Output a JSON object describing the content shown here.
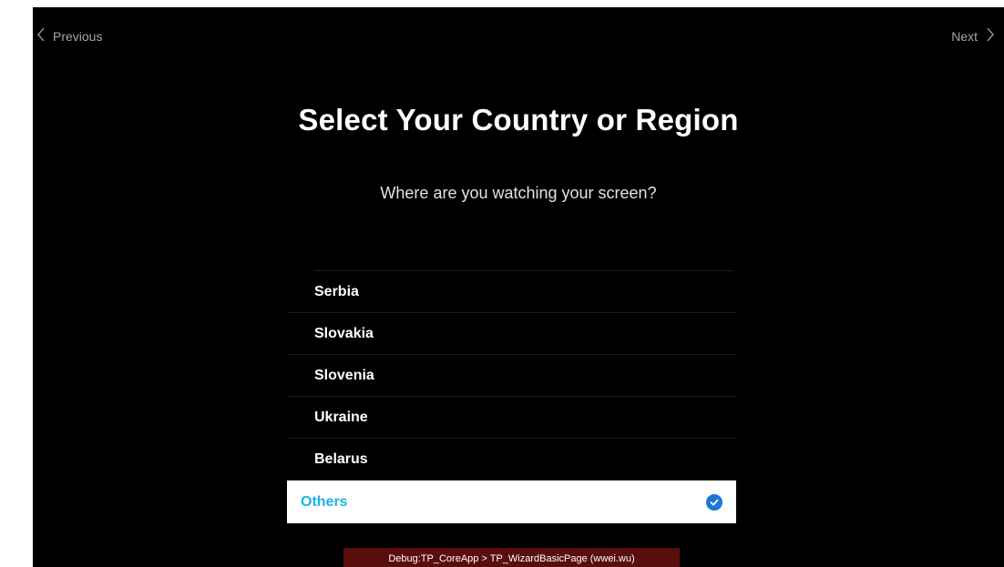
{
  "nav": {
    "previous_label": "Previous",
    "next_label": "Next"
  },
  "page": {
    "title": "Select Your Country or Region",
    "subtitle": "Where are you watching your screen?"
  },
  "countries": [
    {
      "label": "Serbia",
      "selected": false
    },
    {
      "label": "Slovakia",
      "selected": false
    },
    {
      "label": "Slovenia",
      "selected": false
    },
    {
      "label": "Ukraine",
      "selected": false
    },
    {
      "label": "Belarus",
      "selected": false
    },
    {
      "label": "Others",
      "selected": true
    }
  ],
  "debug": {
    "text": "Debug:TP_CoreApp > TP_WizardBasicPage (wwei.wu)"
  },
  "colors": {
    "background": "#000000",
    "selected_text": "#1ab4e8",
    "check_badge": "#1b78d6",
    "debug_bar": "#5a0d0d"
  },
  "icons": {
    "previous": "chevron-left-icon",
    "next": "chevron-right-icon",
    "selected": "check-circle-icon"
  }
}
